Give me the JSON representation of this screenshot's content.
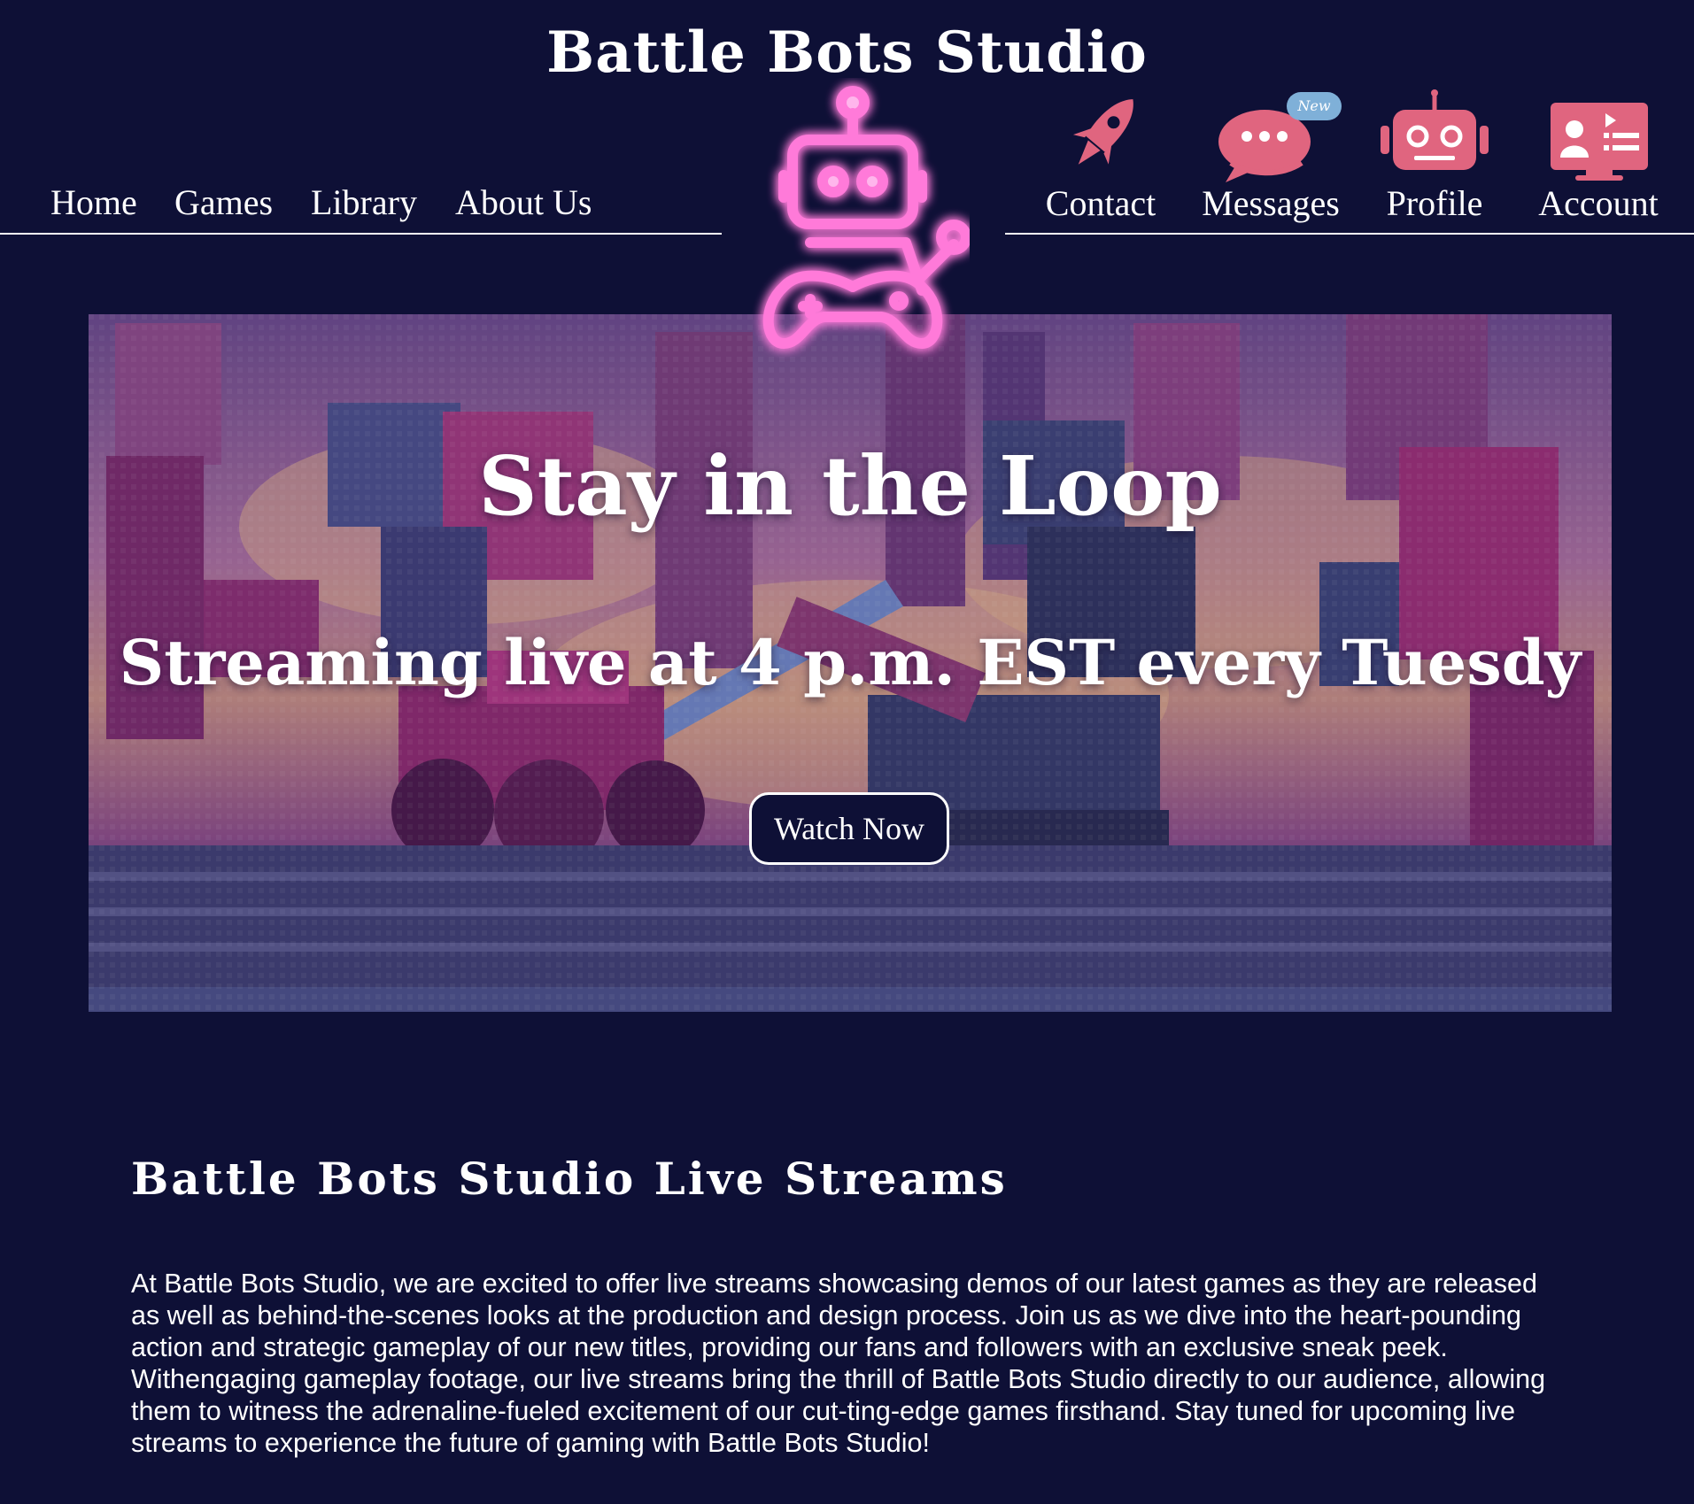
{
  "site": {
    "title": "Battle Bots Studio"
  },
  "nav_left": {
    "items": [
      {
        "label": "Home"
      },
      {
        "label": "Games"
      },
      {
        "label": "Library"
      },
      {
        "label": "About Us"
      }
    ]
  },
  "nav_right": {
    "items": [
      {
        "label": "Contact",
        "icon": "rocket-icon"
      },
      {
        "label": "Messages",
        "icon": "chat-bubble-icon",
        "badge": "New"
      },
      {
        "label": "Profile",
        "icon": "robot-head-icon"
      },
      {
        "label": "Account",
        "icon": "account-card-icon"
      }
    ]
  },
  "logo": {
    "icon": "neon-robot-gamepad-logo"
  },
  "hero": {
    "headline": "Stay in the Loop",
    "subheadline": "Streaming live at 4 p.m. EST every Tuesdy",
    "button_label": "Watch Now"
  },
  "section": {
    "title": "Battle Bots Studio Live Streams",
    "body": "At Battle Bots Studio, we are excited to offer live streams showcasing demos of our latest games as they are released as well as behind-the-scenes looks at the production and design process. Join us as we dive into the heart-pounding action and strategic gameplay of our new titles, providing our fans and followers with an exclusive sneak peek. Withengaging gameplay footage, our live streams bring the thrill of Battle Bots Studio directly to our audience, allowing them to witness the adrenaline-fueled excitement of our cut-ting-edge games firsthand. Stay tuned for upcoming live streams to experience the future of gaming with Battle Bots Studio!"
  },
  "colors": {
    "background": "#0e1036",
    "accent_pink": "#e0657f",
    "neon_pink": "#ff7ad9",
    "badge_blue": "#7fb0d8"
  }
}
